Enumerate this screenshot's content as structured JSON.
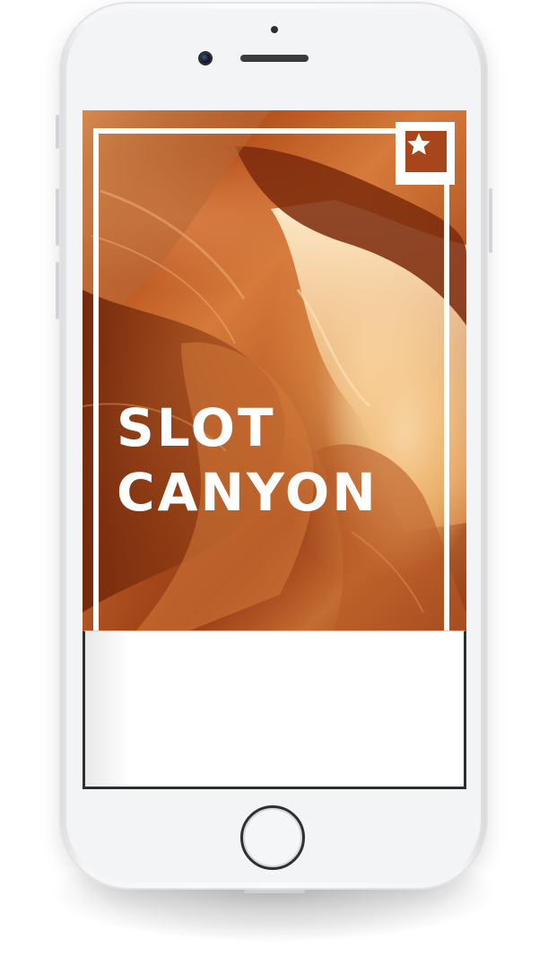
{
  "hero": {
    "title_line_1": "SLOT",
    "title_line_2": "CANYON"
  },
  "icons": {
    "favorite": "star-icon"
  },
  "colors": {
    "badge_background": "#a7461a",
    "frame": "#ffffff",
    "title_text": "#ffffff"
  }
}
